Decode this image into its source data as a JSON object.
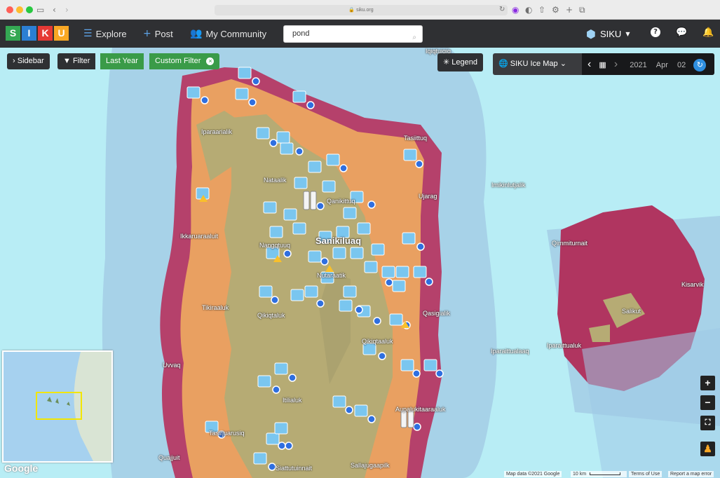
{
  "browser": {
    "url": "siku.org",
    "colors": {
      "close": "#ff5f57",
      "minimize": "#febc2e",
      "maximize": "#28c840"
    }
  },
  "app": {
    "logo_letters": [
      "S",
      "I",
      "K",
      "U"
    ],
    "logo_colors": [
      "#34a853",
      "#2b7fd4",
      "#e53935",
      "#f9a825"
    ],
    "nav": {
      "explore": "Explore",
      "post": "Post",
      "community": "My Community"
    },
    "search_value": "pond",
    "user_label": "SIKU"
  },
  "toolbar": {
    "sidebar": "Sidebar",
    "filter": "Filter",
    "last_year": "Last Year",
    "custom_filter": "Custom Filter",
    "legend": "Legend",
    "map_layer": "SIKU Ice Map",
    "date": {
      "year": "2021",
      "month": "Apr",
      "day": "02"
    }
  },
  "places": {
    "iqiqtuiqiq": "Iqiqtuiqiq",
    "iparaarialik": "Iparaarialik",
    "tasiittuq": "Tasiittuq",
    "nataalik": "Nataalik",
    "qanikittuq": "Qanikittuq",
    "imikinlutjalik": "Imikinlutjalik",
    "ujarag": "Ujarag",
    "ikkaruaraaluit": "Ikkaruaraaluit",
    "sanikiluaq": "Sanikiluaq",
    "nangqtuuq": "Nangqtuuq",
    "qimmiturnait": "Qimmiturnait",
    "nutaraatik": "Nutaraatik",
    "kisarvik": "Kisarvik",
    "tikiraaluk": "Tikiraaluk",
    "salikut": "Salikut",
    "qikiqtaluk": "Qikiqtaluk",
    "qasigialik": "Qasigialik",
    "qikiqtaaluk": "Qikiqtaaluk",
    "iparaittualuk": "Iparaittualuk",
    "iparaittualaaq": "Iparaittualaaq",
    "uvvaq": "Uvvaq",
    "itilialuk": "Itilialuk",
    "aupalukitaaraaluk": "Aupalukitaaraaluk",
    "tasirjuarusiq": "Tasirjuarusiq",
    "quajjuit": "Quajjuit",
    "siattutuinnait": "Siattutuinnait",
    "sallajugaapilk": "Sallajugaapilk"
  },
  "footer": {
    "map_data": "Map data ©2021 Google",
    "scale": "10 km",
    "terms": "Terms of Use",
    "report": "Report a map error",
    "google": "Google"
  },
  "map_controls": {
    "zoom_in": "+",
    "zoom_out": "−"
  },
  "icons": [
    "sidebar-icon",
    "filter-icon",
    "legend-icon",
    "globe-icon",
    "calendar-icon",
    "refresh-icon",
    "help-icon",
    "chat-icon",
    "bell-icon",
    "search-icon",
    "user-avatar-icon",
    "fullscreen-icon",
    "pegman-icon"
  ]
}
